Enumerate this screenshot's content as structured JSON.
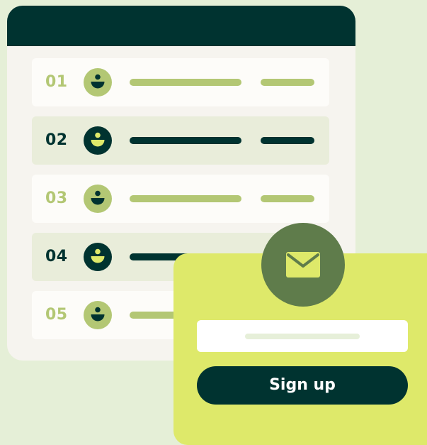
{
  "colors": {
    "background": "#e5efd7",
    "panel": "#f6f4ef",
    "header": "#003330",
    "accent_light": "#b3c774",
    "accent_dark": "#003330",
    "card": "#dee96a",
    "badge": "#5f7c4b",
    "highlight": "#dee96a"
  },
  "list": {
    "rows": [
      {
        "number": "01",
        "style": "light",
        "icon": "user-avatar-icon"
      },
      {
        "number": "02",
        "style": "tinted",
        "icon": "user-avatar-icon"
      },
      {
        "number": "03",
        "style": "light",
        "icon": "user-avatar-icon"
      },
      {
        "number": "04",
        "style": "tinted",
        "icon": "user-avatar-icon"
      },
      {
        "number": "05",
        "style": "light",
        "icon": "user-avatar-icon"
      }
    ]
  },
  "signup": {
    "icon": "envelope-icon",
    "button_label": "Sign up"
  }
}
